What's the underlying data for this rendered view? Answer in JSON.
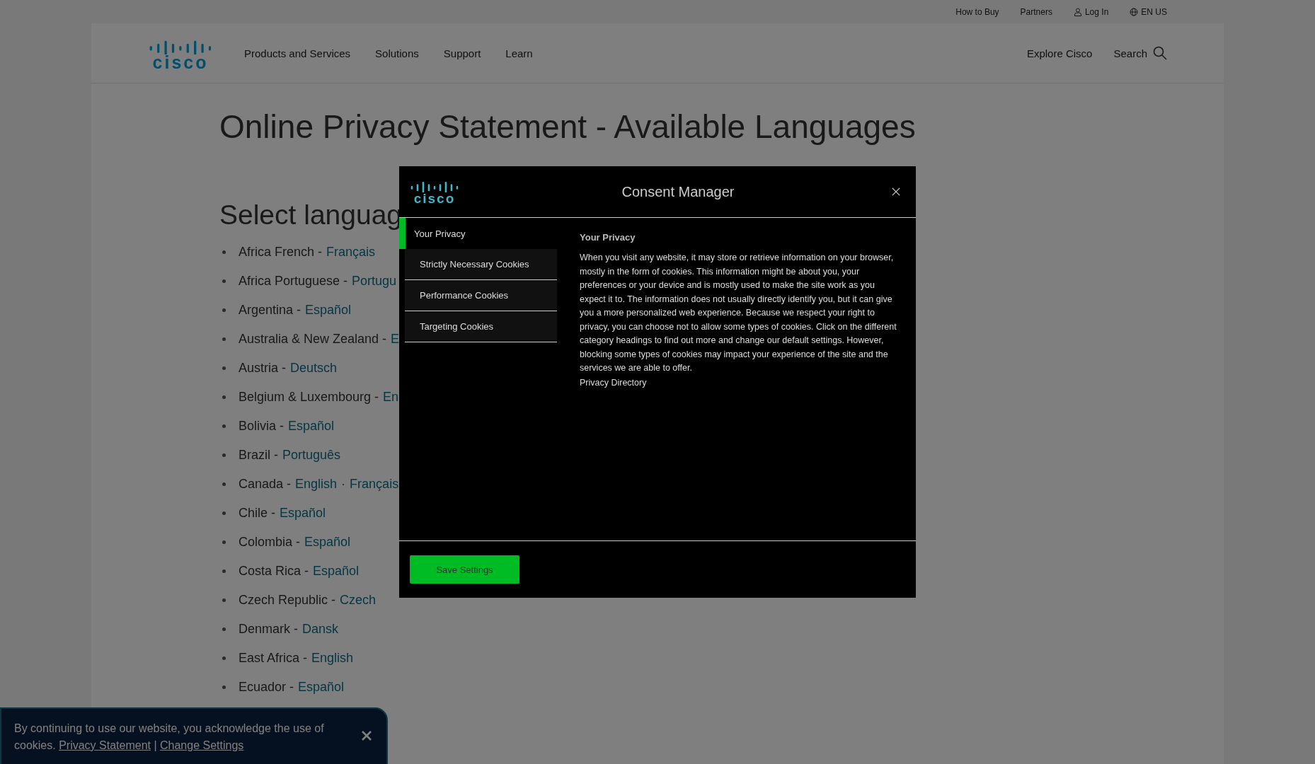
{
  "utility_links": [
    {
      "label": "How to Buy"
    },
    {
      "label": "Partners"
    },
    {
      "label": "Log In",
      "kind": "user"
    },
    {
      "label": "EN US",
      "kind": "globe"
    }
  ],
  "header": {
    "logo": "cisco",
    "nav": [
      "Products and Services",
      "Solutions",
      "Support",
      "Learn"
    ],
    "explore": "Explore Cisco",
    "search": "Search"
  },
  "page": {
    "title": "Online Privacy Statement - Available Languages",
    "subtitle": "Select languag",
    "languages": [
      {
        "country": "Africa French -",
        "links": [
          "Français"
        ]
      },
      {
        "country": "Africa Portuguese -",
        "links": [
          "Portugu"
        ]
      },
      {
        "country": "Argentina -",
        "links": [
          "Español"
        ]
      },
      {
        "country": "Australia & New Zealand -",
        "links": [
          "E"
        ]
      },
      {
        "country": "Austria -",
        "links": [
          "Deutsch"
        ]
      },
      {
        "country": "Belgium & Luxembourg -",
        "links": [
          "En"
        ]
      },
      {
        "country": "Bolivia -",
        "links": [
          "Español"
        ]
      },
      {
        "country": "Brazil -",
        "links": [
          "Português"
        ]
      },
      {
        "country": "Canada -",
        "links": [
          "English",
          "Français"
        ],
        "separator": "·"
      },
      {
        "country": "Chile -",
        "links": [
          "Español"
        ]
      },
      {
        "country": "Colombia -",
        "links": [
          "Español"
        ]
      },
      {
        "country": "Costa Rica -",
        "links": [
          "Español"
        ]
      },
      {
        "country": "Czech Republic -",
        "links": [
          "Czech"
        ]
      },
      {
        "country": "Denmark -",
        "links": [
          "Dansk"
        ]
      },
      {
        "country": "East Africa -",
        "links": [
          "English"
        ]
      },
      {
        "country": "Ecuador -",
        "links": [
          "Español"
        ]
      }
    ]
  },
  "consent_manager": {
    "logo": "cisco",
    "title": "Consent Manager",
    "tabs": [
      {
        "label": "Your Privacy",
        "selected": true
      },
      {
        "label": "Strictly Necessary Cookies",
        "selected": false
      },
      {
        "label": "Performance Cookies",
        "selected": false
      },
      {
        "label": "Targeting Cookies",
        "selected": false
      }
    ],
    "heading": "Your Privacy",
    "body": "When you visit any website, it may store or retrieve information on your browser, mostly in the form of cookies. This information might be about you, your preferences or your device and is mostly used to make the site work as you expect it to. The information does not usually directly identify you, but it can give you a more personalized web experience. Because we respect your right to privacy, you can choose not to allow some types of cookies. Click on the different category headings to find out more and change our default settings. However, blocking some types of cookies may impact your experience of the site and the services we are able to offer.",
    "link": "Privacy Directory",
    "save": "Save Settings"
  },
  "cookie_banner": {
    "text": "By continuing to use our website, you acknowledge the use of cookies.",
    "links": [
      "Privacy Statement",
      "Change Settings"
    ],
    "separator": "|"
  }
}
